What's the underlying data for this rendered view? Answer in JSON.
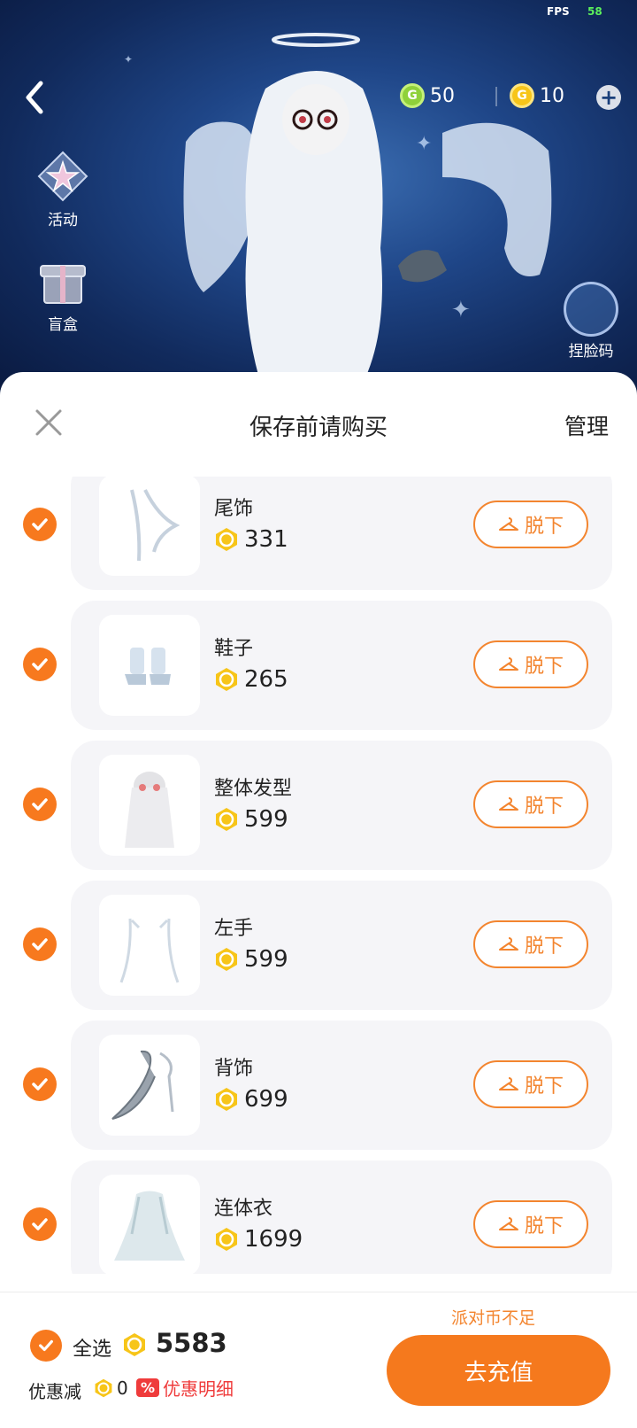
{
  "status": {
    "fps_label": "FPS",
    "fps_value": "58"
  },
  "top_bar": {
    "green_currency": "50",
    "gold_currency": "10"
  },
  "side_buttons": [
    {
      "label": "活动",
      "icon": "star-badge-icon"
    },
    {
      "label": "盲盒",
      "icon": "gift-box-icon"
    }
  ],
  "face_button": {
    "label": "捏脸码"
  },
  "sheet": {
    "title": "保存前请购买",
    "manage": "管理"
  },
  "items": [
    {
      "name": "尾饰",
      "price": "331",
      "action": "脱下",
      "thumb": "tail-accessory"
    },
    {
      "name": "鞋子",
      "price": "265",
      "action": "脱下",
      "thumb": "shoes"
    },
    {
      "name": "整体发型",
      "price": "599",
      "action": "脱下",
      "thumb": "hairstyle"
    },
    {
      "name": "左手",
      "price": "599",
      "action": "脱下",
      "thumb": "left-hand"
    },
    {
      "name": "背饰",
      "price": "699",
      "action": "脱下",
      "thumb": "back-accessory"
    },
    {
      "name": "连体衣",
      "price": "1699",
      "action": "脱下",
      "thumb": "jumpsuit"
    }
  ],
  "footer": {
    "select_all": "全选",
    "total": "5583",
    "discount_label": "优惠减",
    "discount_value": "0",
    "discount_tag": "%",
    "discount_detail": "优惠明细",
    "insufficient": "派对币不足",
    "recharge": "去充值"
  },
  "colors": {
    "accent": "#f5791d",
    "card_bg": "#f5f5f8",
    "gold": "#f7c519",
    "green": "#8fd13a"
  }
}
